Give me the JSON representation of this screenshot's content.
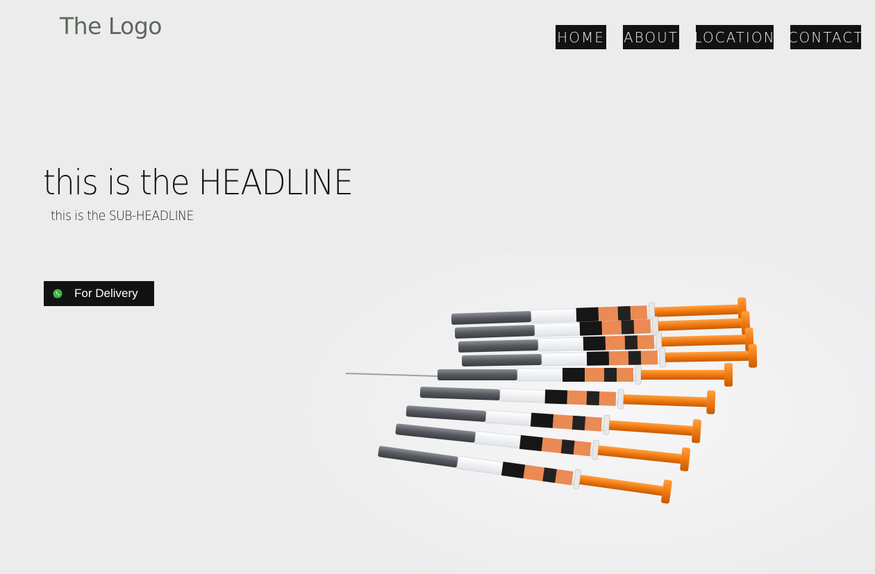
{
  "header": {
    "logo_text": "The Logo",
    "nav": [
      {
        "label": "HOME"
      },
      {
        "label": "ABOUT"
      },
      {
        "label": "LOCATION"
      },
      {
        "label": "CONTACT"
      }
    ]
  },
  "hero": {
    "headline": "this is the HEADLINE",
    "subheadline": "this is the SUB-HEADLINE",
    "cta": {
      "label": "For Delivery",
      "icon": "whatsapp-icon",
      "icon_color": "#3fb44a"
    },
    "image": {
      "subject": "syringes-photo"
    }
  },
  "colors": {
    "background": "#ececed",
    "button_background": "#121212",
    "logo_color": "#5d675d",
    "accent_orange": "#f07a10"
  }
}
